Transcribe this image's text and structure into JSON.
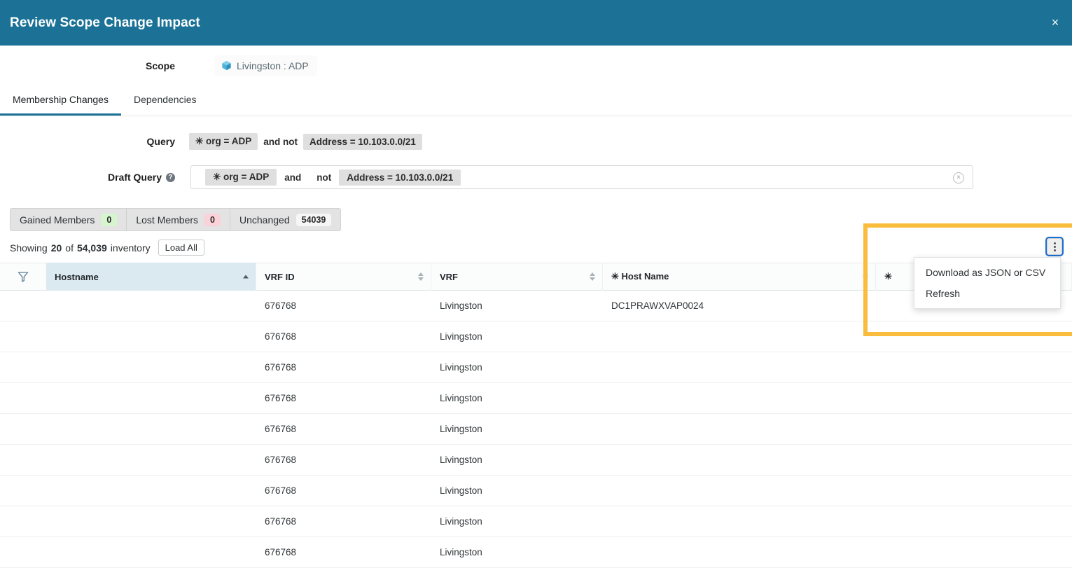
{
  "modal": {
    "title": "Review Scope Change Impact",
    "close_label": "×"
  },
  "scope": {
    "label": "Scope",
    "chip_text": "Livingston : ADP",
    "chip_icon": "cube-icon"
  },
  "tabs": [
    {
      "label": "Membership Changes",
      "active": true
    },
    {
      "label": "Dependencies",
      "active": false
    }
  ],
  "query": {
    "label": "Query",
    "tokens": [
      {
        "type": "token",
        "text": "✳ org = ADP"
      },
      {
        "type": "operator",
        "text": "and not"
      },
      {
        "type": "token",
        "text": "Address = 10.103.0.0/21"
      }
    ]
  },
  "draft_query": {
    "label": "Draft Query",
    "help_icon_label": "?",
    "clear_label": "×",
    "tokens": [
      {
        "type": "token",
        "text": "✳ org  =  ADP"
      },
      {
        "type": "operator",
        "text": "and"
      },
      {
        "type": "operator",
        "text": "not"
      },
      {
        "type": "token",
        "text": "Address  =  10.103.0.0/21"
      }
    ]
  },
  "segments": [
    {
      "label": "Gained Members",
      "count": "0",
      "tone": "green"
    },
    {
      "label": "Lost Members",
      "count": "0",
      "tone": "red"
    },
    {
      "label": "Unchanged",
      "count": "54039",
      "tone": "grey"
    }
  ],
  "showing": {
    "prefix": "Showing",
    "shown": "20",
    "mid": "of",
    "total": "54,039",
    "suffix": "inventory",
    "load_all_label": "Load All"
  },
  "table": {
    "filter_icon": "filter-icon",
    "columns": [
      {
        "key": "hostname",
        "label": "Hostname",
        "sort": "asc"
      },
      {
        "key": "vrf_id",
        "label": "VRF ID",
        "sort": "none"
      },
      {
        "key": "vrf",
        "label": "VRF",
        "sort": "none"
      },
      {
        "key": "host_name",
        "label": "✳ Host Name",
        "sort": "none"
      },
      {
        "key": "last_col",
        "label": "✳",
        "sort": "none"
      }
    ],
    "rows": [
      {
        "hostname": "",
        "vrf_id": "676768",
        "vrf": "Livingston",
        "host_name": "DC1PRAWXVAP0024",
        "last_col": ""
      },
      {
        "hostname": "",
        "vrf_id": "676768",
        "vrf": "Livingston",
        "host_name": "",
        "last_col": ""
      },
      {
        "hostname": "",
        "vrf_id": "676768",
        "vrf": "Livingston",
        "host_name": "",
        "last_col": ""
      },
      {
        "hostname": "",
        "vrf_id": "676768",
        "vrf": "Livingston",
        "host_name": "",
        "last_col": ""
      },
      {
        "hostname": "",
        "vrf_id": "676768",
        "vrf": "Livingston",
        "host_name": "",
        "last_col": ""
      },
      {
        "hostname": "",
        "vrf_id": "676768",
        "vrf": "Livingston",
        "host_name": "",
        "last_col": ""
      },
      {
        "hostname": "",
        "vrf_id": "676768",
        "vrf": "Livingston",
        "host_name": "",
        "last_col": ""
      },
      {
        "hostname": "",
        "vrf_id": "676768",
        "vrf": "Livingston",
        "host_name": "",
        "last_col": ""
      },
      {
        "hostname": "",
        "vrf_id": "676768",
        "vrf": "Livingston",
        "host_name": "",
        "last_col": ""
      }
    ]
  },
  "actions_menu": {
    "button_icon": "kebab-menu-icon",
    "items": [
      {
        "label": "Download as JSON or CSV"
      },
      {
        "label": "Refresh"
      }
    ]
  },
  "colors": {
    "header_blue": "#1b7296",
    "tab_accent": "#1b7296",
    "highlight_yellow": "#fabc3c",
    "sorted_col": "#dbeaf1",
    "badge_green": "#d6f5cf",
    "badge_red": "#fbd2d8"
  }
}
